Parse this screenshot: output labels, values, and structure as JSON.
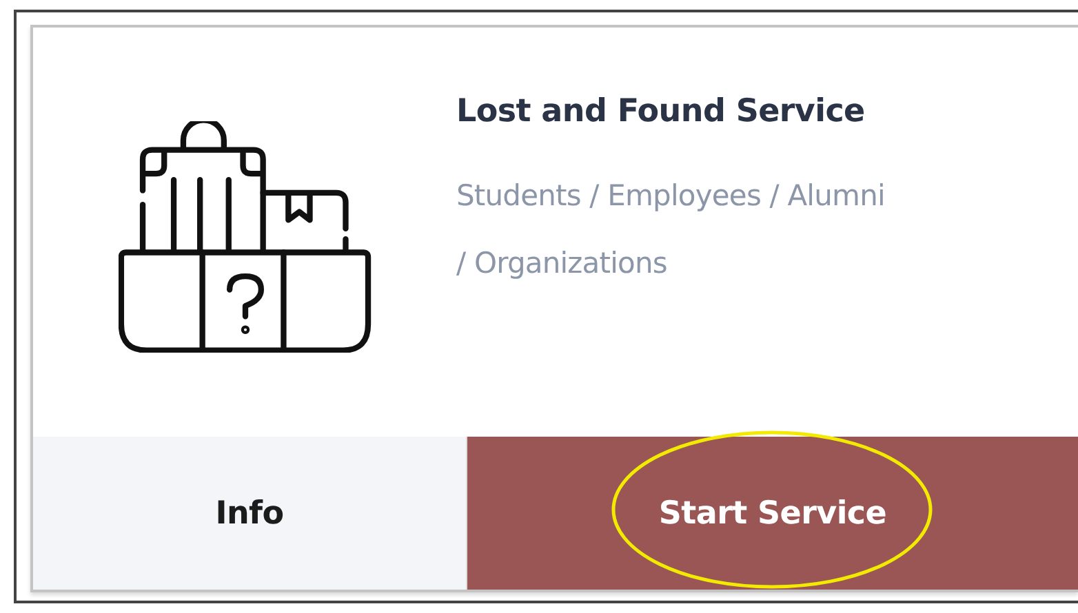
{
  "service": {
    "title": "Lost and Found Service",
    "audience": "Students / Employees / Alumni / Organizations"
  },
  "actions": [
    {
      "label": "Info",
      "kind": "secondary",
      "highlighted": false
    },
    {
      "label": "Start Service",
      "kind": "primary",
      "highlighted": true
    }
  ]
}
